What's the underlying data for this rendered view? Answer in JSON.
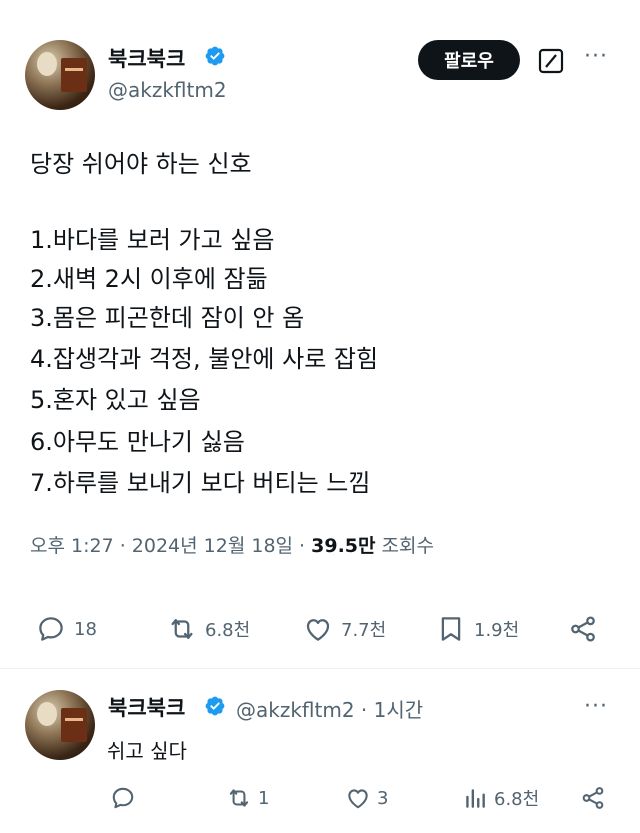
{
  "tweet": {
    "author_name": "북크북크",
    "handle": "@akzkfltm2",
    "follow_label": "팔로우",
    "text_lines": [
      "당장 쉬어야 하는 신호",
      "1.바다를 보러 가고 싶음",
      "2.새벽 2시 이후에 잠듦",
      "3.몸은 피곤한데 잠이 안 옴",
      "4.잡생각과 걱정, 불안에 사로 잡힘",
      "5.혼자 있고 싶음",
      "6.아무도 만나기 싫음",
      "7.하루를 보내기 보다 버티는 느낌"
    ],
    "time": "오후 1:27 · 2024년 12월 18일 · ",
    "views_count": "39.5만",
    "views_label": " 조회수",
    "stats": {
      "replies": "18",
      "retweets": "6.8천",
      "likes": "7.7천",
      "bookmarks": "1.9천"
    },
    "icons": {
      "verified": "verified-badge-icon",
      "grok": "grok-icon",
      "more": "more-icon",
      "reply": "reply-icon",
      "retweet": "retweet-icon",
      "like": "heart-icon",
      "bookmark": "bookmark-icon",
      "share": "share-icon"
    }
  },
  "reply": {
    "author_name": "북크북크",
    "handle_time": "@akzkfltm2 · 1시간",
    "text": "쉬고 싶다",
    "stats": {
      "replies": "",
      "retweets": "1",
      "likes": "3",
      "views": "6.8천"
    },
    "icons": {
      "views": "views-chart-icon"
    }
  },
  "colors": {
    "verified": "#1d9bf0",
    "text": "#0f1419",
    "muted": "#536471",
    "button_bg": "#0f1419"
  }
}
